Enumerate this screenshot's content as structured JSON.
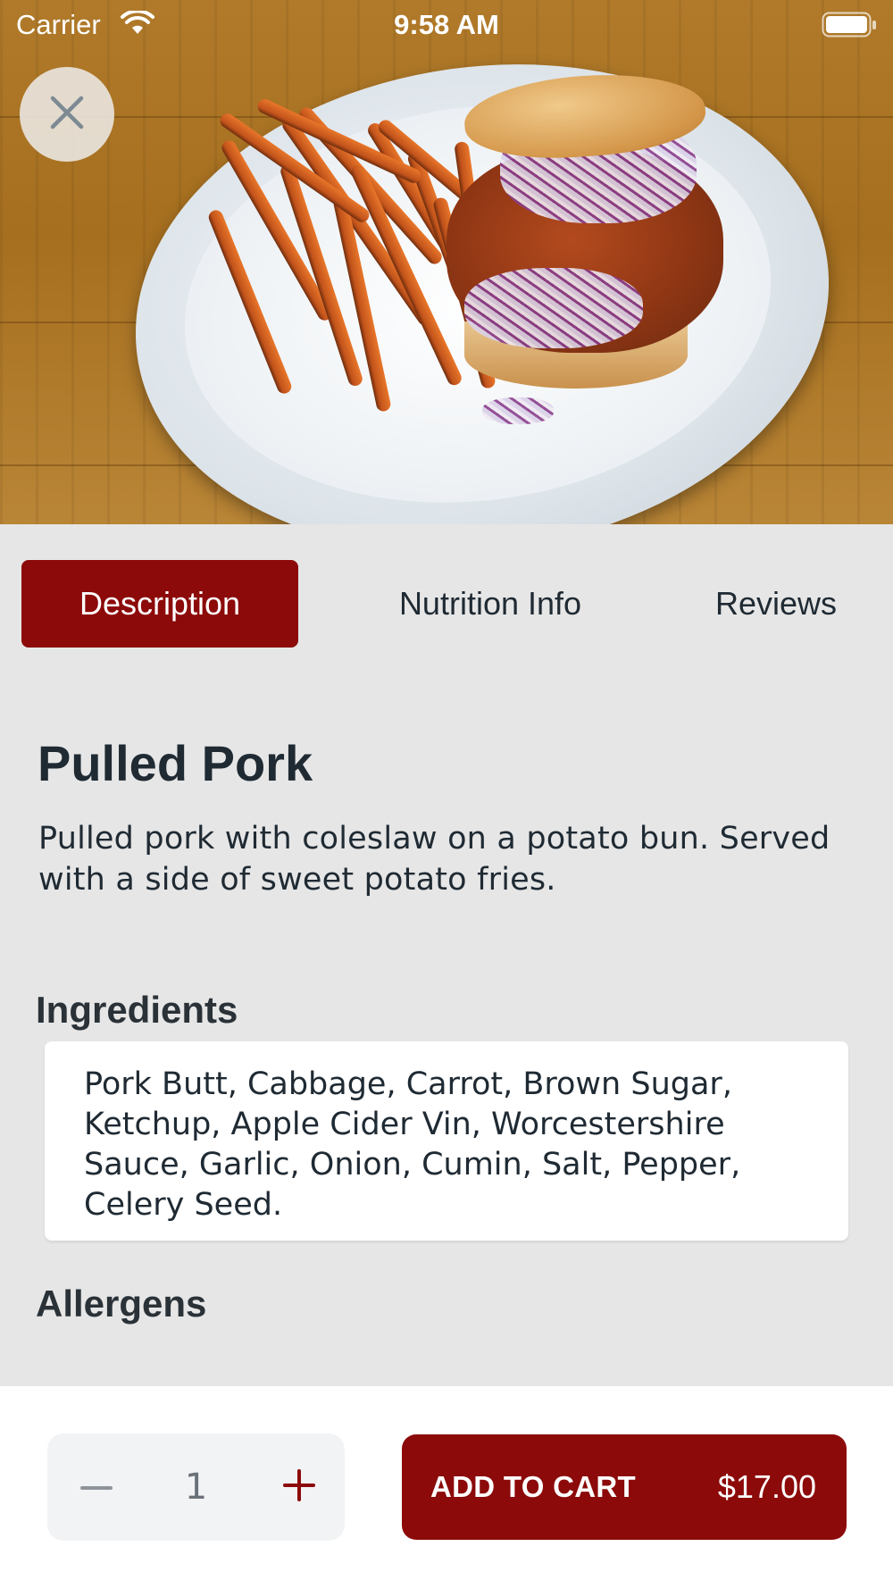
{
  "status_bar": {
    "carrier": "Carrier",
    "time": "9:58 AM",
    "icons": [
      "wifi-icon",
      "battery-icon"
    ]
  },
  "header": {
    "close_icon": "close-icon"
  },
  "tabs": [
    {
      "label": "Description",
      "active": true
    },
    {
      "label": "Nutrition Info",
      "active": false
    },
    {
      "label": "Reviews",
      "active": false
    }
  ],
  "item": {
    "name": "Pulled Pork",
    "description": "Pulled pork with coleslaw on a potato bun. Served with a side of sweet potato fries.",
    "ingredients_heading": "Ingredients",
    "ingredients": "Pork Butt, Cabbage, Carrot, Brown Sugar, Ketchup, Apple Cider Vin, Worcestershire Sauce, Garlic, Onion, Cumin, Salt, Pepper, Celery Seed.",
    "allergens_heading": "Allergens"
  },
  "cart": {
    "quantity": "1",
    "add_label": "ADD TO CART",
    "price": "$17.00"
  },
  "colors": {
    "accent": "#8c0a0a",
    "background": "#e6e6e6",
    "text": "#1f2a33"
  }
}
